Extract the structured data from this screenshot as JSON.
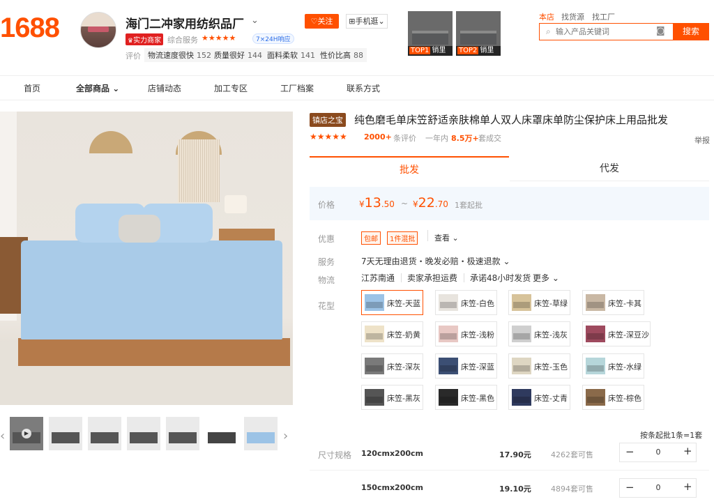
{
  "logo": "1688",
  "shop": {
    "name": "海门二冲家用纺织品厂",
    "badge": "实力商家",
    "service_label": "综合服务",
    "stars": "★★★★★",
    "service_24": "7×24H响应",
    "rating_label": "评价",
    "ratings": [
      {
        "label": "物流速度很快",
        "count": "152"
      },
      {
        "label": "质量很好",
        "count": "144"
      },
      {
        "label": "面料柔软",
        "count": "141"
      },
      {
        "label": "性价比高",
        "count": "88"
      }
    ],
    "follow": "关注",
    "mobile": "手机逛",
    "top_products": [
      {
        "rank": "TOP1",
        "label": "销里"
      },
      {
        "rank": "TOP2",
        "label": "销里"
      }
    ]
  },
  "search": {
    "tabs": [
      "本店",
      "找货源",
      "找工厂"
    ],
    "placeholder": "输入产品关键词",
    "button": "搜索"
  },
  "nav": [
    "首页",
    "全部商品",
    "店铺动态",
    "加工专区",
    "工厂档案",
    "联系方式"
  ],
  "product": {
    "tag": "镇店之宝",
    "title": "纯色磨毛单床笠舒适亲肤棉单人双人床罩床单防尘保护床上用品批发",
    "stars": "★★★★★",
    "reviews": "2000+",
    "reviews_label": "条评价",
    "sold_label": "一年内",
    "sold": "8.5万+",
    "sold_suffix": "套成交",
    "report": "举报"
  },
  "tabs": {
    "wholesale": "批发",
    "dropship": "代发"
  },
  "price": {
    "label": "价格",
    "currency": "¥",
    "low_int": "13",
    "low_dec": ".50",
    "tilde": "~",
    "high_int": "22",
    "high_dec": ".70",
    "moq": "1套起批"
  },
  "promo": {
    "label": "优惠",
    "tags": [
      "包邮",
      "1件混批"
    ],
    "view": "查看"
  },
  "service": {
    "label": "服务",
    "text": "7天无理由退货・晚发必赔・极速退款"
  },
  "logistics": {
    "label": "物流",
    "origin": "江苏南通",
    "fee": "卖家承担运费",
    "ship": "承诺48小时发货",
    "more": "更多"
  },
  "variants": {
    "label": "花型",
    "items": [
      {
        "name": "床笠-天蓝",
        "color": "#9cc3e6"
      },
      {
        "name": "床笠-白色",
        "color": "#e8e4de"
      },
      {
        "name": "床笠-草绿",
        "color": "#d7c39a"
      },
      {
        "name": "床笠-卡其",
        "color": "#c9b8a4"
      },
      {
        "name": "床笠-奶黄",
        "color": "#eee2c8"
      },
      {
        "name": "床笠-浅粉",
        "color": "#e8c8c4"
      },
      {
        "name": "床笠-浅灰",
        "color": "#cfcfcf"
      },
      {
        "name": "床笠-深豆沙",
        "color": "#9e4a5e"
      },
      {
        "name": "床笠-深灰",
        "color": "#7a7a7a"
      },
      {
        "name": "床笠-深蓝",
        "color": "#3c4f74"
      },
      {
        "name": "床笠-玉色",
        "color": "#ded6c2"
      },
      {
        "name": "床笠-水绿",
        "color": "#b6d6da"
      },
      {
        "name": "床笠-黑灰",
        "color": "#555555"
      },
      {
        "name": "床笠-黑色",
        "color": "#2a2a2a"
      },
      {
        "name": "床笠-丈青",
        "color": "#2f3a5e"
      },
      {
        "name": "床笠-棕色",
        "color": "#8a6a4a"
      }
    ],
    "selected": "床笠-天蓝"
  },
  "batch_note": "按条起批1条=1套",
  "sizes": {
    "label": "尺寸规格",
    "items": [
      {
        "name": "120cmx200cm",
        "price": "17.90元",
        "stock": "4262套可售",
        "qty": "0"
      },
      {
        "name": "150cmx200cm",
        "price": "19.10元",
        "stock": "4894套可售",
        "qty": "0"
      }
    ],
    "minus": "−",
    "plus": "+"
  },
  "colors": {
    "accent": "#ff5000",
    "price_bg": "#f3f8fd"
  }
}
